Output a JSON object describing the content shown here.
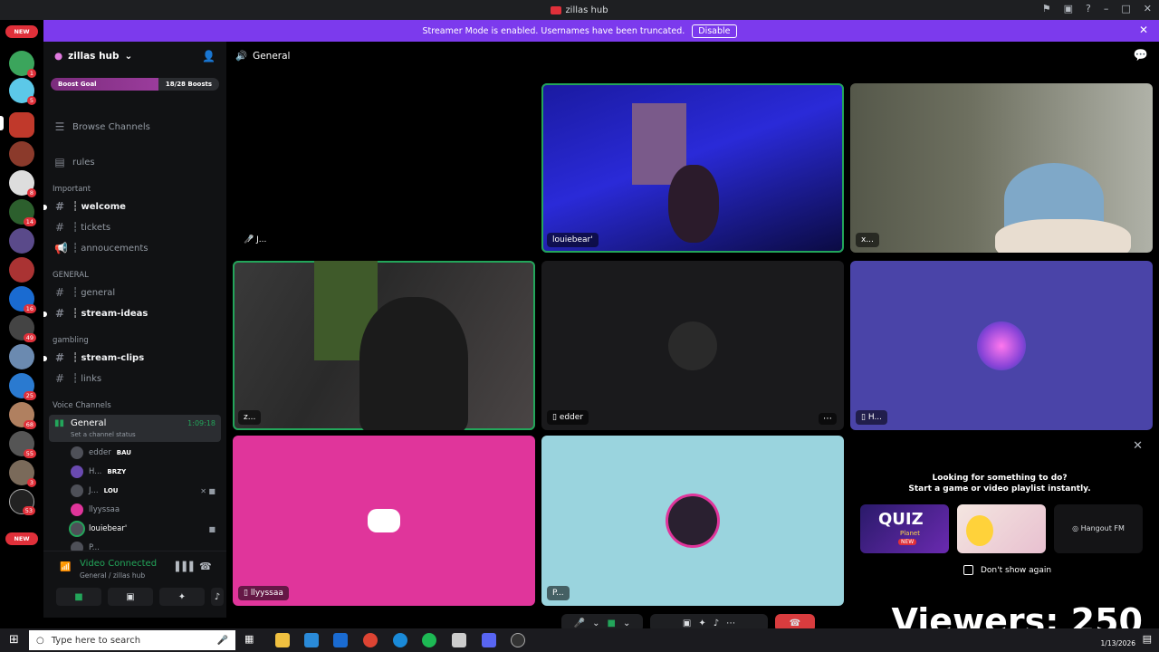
{
  "window": {
    "title": "zillas hub"
  },
  "banner": {
    "text": "Streamer Mode is enabled. Usernames have been truncated.",
    "button": "Disable"
  },
  "guild_rail": {
    "new_top": "NEW",
    "new_bottom": "NEW",
    "badges": [
      "1",
      "5",
      "8",
      "14",
      "16",
      "49",
      "25",
      "68",
      "55",
      "3",
      "53"
    ]
  },
  "server": {
    "name": "zillas hub",
    "boost_goal": "Boost Goal",
    "boost_count": "18/28 Boosts",
    "boost_fraction": 0.64
  },
  "channels": {
    "browse": "Browse Channels",
    "rules": "rules",
    "cat_important": "Important",
    "welcome": "┆ welcome",
    "tickets": "┆ tickets",
    "announcements": "┆ annoucements",
    "cat_general": "GENERAL",
    "general": "┆ general",
    "stream_ideas": "┆ stream-ideas",
    "cat_gambling": "gambling",
    "stream_clips": "┆ stream-clips",
    "links": "┆ links",
    "cat_voice": "Voice Channels",
    "voice_general": "General",
    "voice_timer": "1:09:18",
    "voice_status": "Set a channel status",
    "users": [
      {
        "name": "edder",
        "tag": "BAU"
      },
      {
        "name": "H...",
        "tag": "BRZY"
      },
      {
        "name": "J...",
        "tag": "LOU"
      },
      {
        "name": "llyyssaa",
        "tag": ""
      },
      {
        "name": "louiebear'",
        "tag": ""
      },
      {
        "name": "P...",
        "tag": ""
      }
    ]
  },
  "voice_connected": {
    "status": "Video Connected",
    "location": "General / zillas hub"
  },
  "main": {
    "channel": "General",
    "tiles": {
      "t1": "J...",
      "t2": "louiebear'",
      "t3": "x...",
      "t4": "z...",
      "t5": "edder",
      "t6": "H...",
      "t7": "llyyssaa",
      "t8": "P..."
    },
    "activity": {
      "line1": "Looking for something to do?",
      "line2": "Start a game or video playlist instantly.",
      "card1": "QUIZ",
      "card1_sub": "Planet",
      "card1_new": "NEW",
      "card3": "Hangout FM",
      "dont_show": "Don't show again"
    }
  },
  "overlay": {
    "viewers": "Viewers: 250"
  },
  "taskbar": {
    "search_placeholder": "Type here to search",
    "date": "1/13/2026"
  },
  "colors": {
    "accent": "#7c3aed",
    "speaking": "#23a55a",
    "discord": "#5865f2",
    "pink": "#e0359b",
    "teal": "#9ad4de"
  }
}
